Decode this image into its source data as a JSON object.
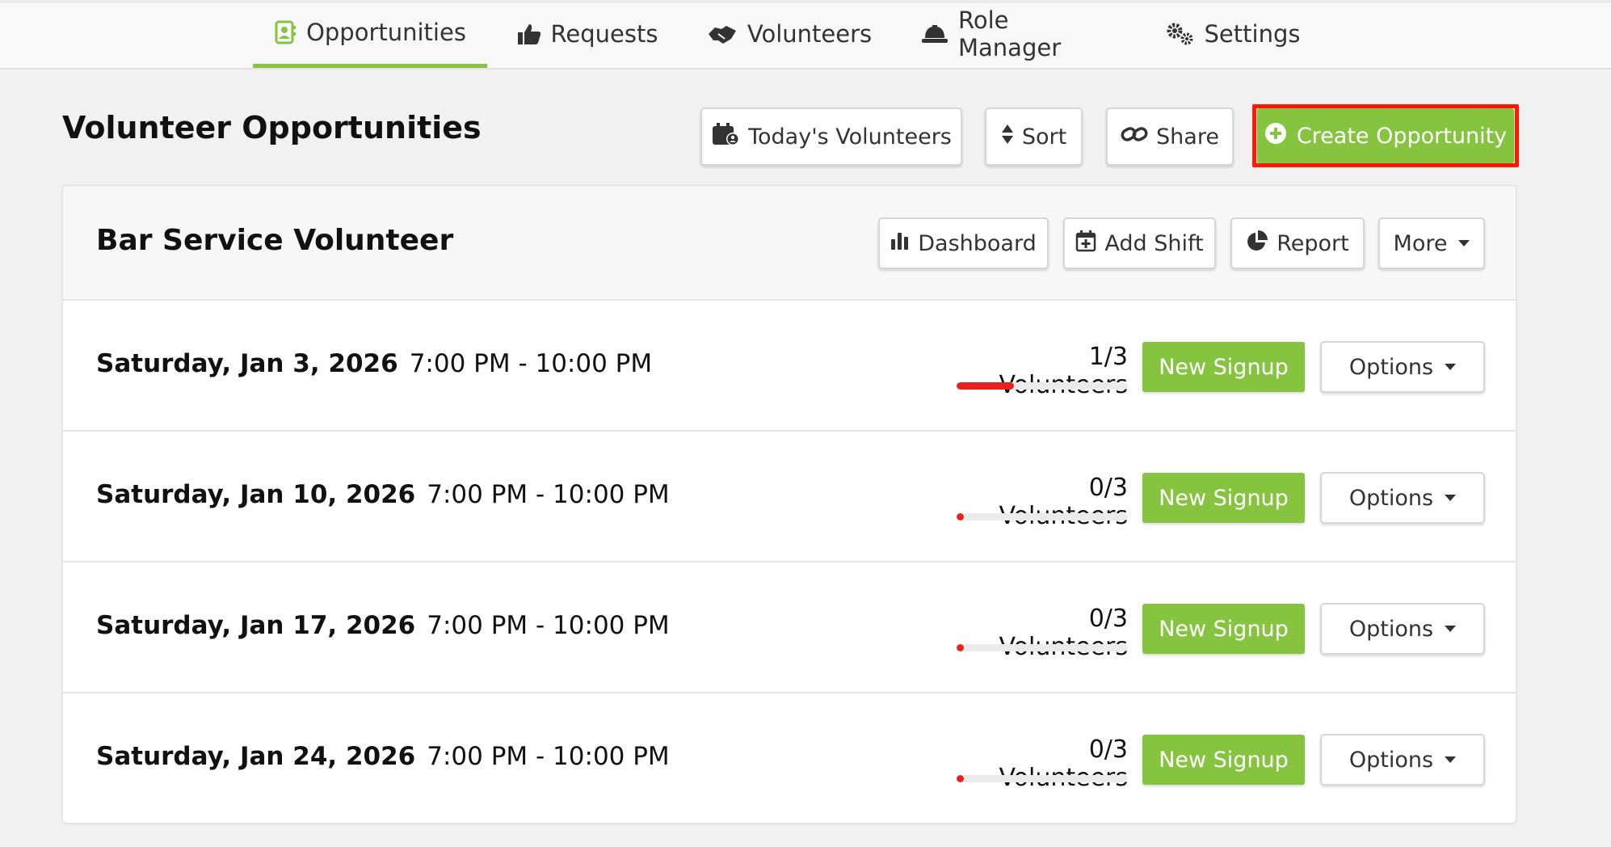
{
  "nav": {
    "tabs": [
      {
        "label": "Opportunities",
        "icon": "contact-book-icon",
        "active": true
      },
      {
        "label": "Requests",
        "icon": "thumbs-up-icon",
        "active": false
      },
      {
        "label": "Volunteers",
        "icon": "handshake-icon",
        "active": false
      },
      {
        "label": "Role Manager",
        "icon": "hard-hat-icon",
        "active": false
      },
      {
        "label": "Settings",
        "icon": "gears-icon",
        "active": false
      }
    ]
  },
  "page": {
    "title": "Volunteer Opportunities",
    "buttons": {
      "todays_volunteers": "Today's Volunteers",
      "sort": "Sort",
      "share": "Share",
      "create_opportunity": "Create Opportunity"
    }
  },
  "opportunity": {
    "title": "Bar Service Volunteer",
    "buttons": {
      "dashboard": "Dashboard",
      "add_shift": "Add Shift",
      "report": "Report",
      "more": "More"
    },
    "shifts": [
      {
        "date": "Saturday, Jan 3, 2026",
        "time": "7:00 PM - 10:00 PM",
        "volunteers": "1/3 Volunteers",
        "fill": 0.333,
        "signup": "New Signup",
        "options": "Options"
      },
      {
        "date": "Saturday, Jan 10, 2026",
        "time": "7:00 PM - 10:00 PM",
        "volunteers": "0/3 Volunteers",
        "fill": 0,
        "signup": "New Signup",
        "options": "Options"
      },
      {
        "date": "Saturday, Jan 17, 2026",
        "time": "7:00 PM - 10:00 PM",
        "volunteers": "0/3 Volunteers",
        "fill": 0,
        "signup": "New Signup",
        "options": "Options"
      },
      {
        "date": "Saturday, Jan 24, 2026",
        "time": "7:00 PM - 10:00 PM",
        "volunteers": "0/3 Volunteers",
        "fill": 0,
        "signup": "New Signup",
        "options": "Options"
      }
    ]
  },
  "colors": {
    "accent": "#86c440",
    "highlight": "#ff1a00",
    "progress": "#e8201f"
  }
}
